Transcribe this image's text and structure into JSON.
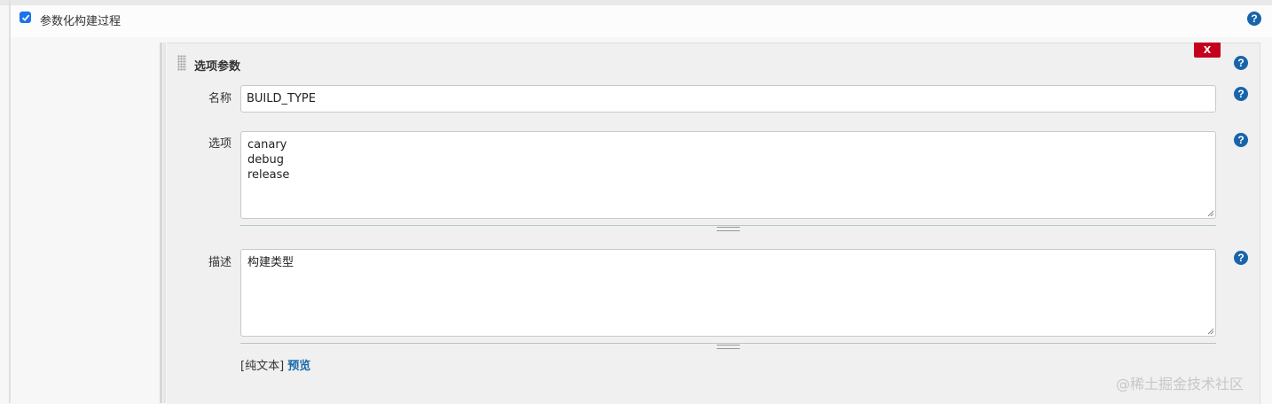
{
  "section": {
    "checkbox_checked": true,
    "title": "参数化构建过程"
  },
  "parameter": {
    "type_title": "选项参数",
    "delete_label": "X",
    "name_label": "名称",
    "name_value": "BUILD_TYPE",
    "choices_label": "选项",
    "choices": [
      "canary",
      "debug",
      "release"
    ],
    "description_label": "描述",
    "description_value": "构建类型",
    "plain_text_label": "[纯文本]",
    "preview_label": "预览"
  },
  "watermark": "@稀土掘金技术社区",
  "colors": {
    "accent": "#1a73e8",
    "help_icon": "#1864ab",
    "delete": "#c4001c",
    "link": "#1a6aa8"
  }
}
